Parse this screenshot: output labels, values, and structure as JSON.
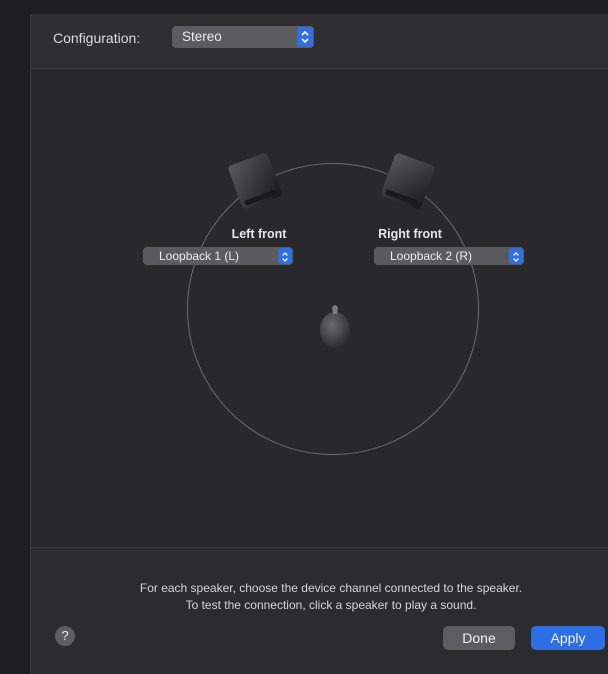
{
  "configuration": {
    "label": "Configuration:",
    "selected": "Stereo"
  },
  "speakers": [
    {
      "label": "Left front",
      "channel": "Loopback 1 (L)"
    },
    {
      "label": "Right front",
      "channel": "Loopback 2 (R)"
    }
  ],
  "instructions": {
    "line1": "For each speaker, choose the device channel connected to the speaker.",
    "line2": "To test the connection, click a speaker to play a sound."
  },
  "buttons": {
    "help": "?",
    "done": "Done",
    "apply": "Apply"
  },
  "colors": {
    "accent": "#2d6fe3",
    "panel": "#2c2c2e"
  }
}
